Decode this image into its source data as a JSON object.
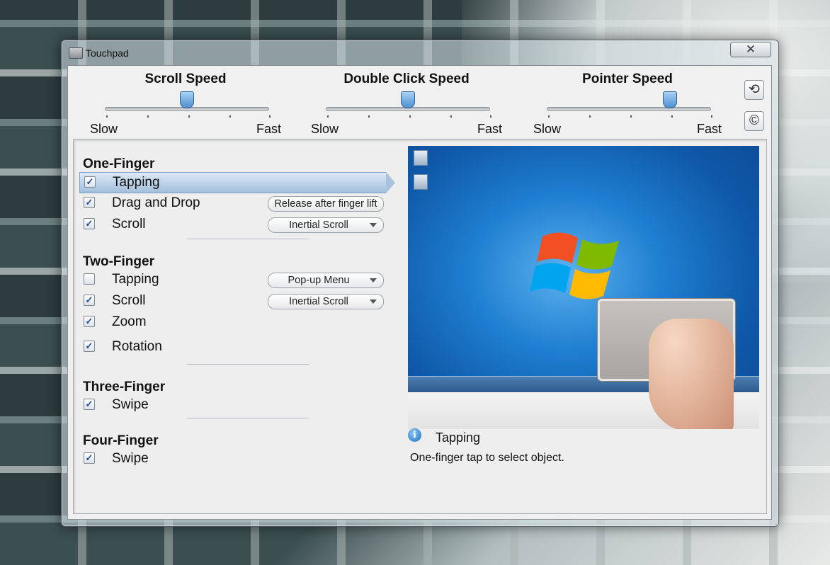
{
  "window": {
    "title": "Touchpad",
    "close_label": "✕"
  },
  "sliders": [
    {
      "title": "Scroll Speed",
      "min_label": "Slow",
      "max_label": "Fast",
      "value": 0.5
    },
    {
      "title": "Double Click Speed",
      "min_label": "Slow",
      "max_label": "Fast",
      "value": 0.5
    },
    {
      "title": "Pointer Speed",
      "min_label": "Slow",
      "max_label": "Fast",
      "value": 0.75
    }
  ],
  "side_buttons": {
    "reset_icon": "refresh-icon",
    "copyright_icon": "copyright-icon",
    "reset_glyph": "⟲",
    "copyright_glyph": "©"
  },
  "sections": {
    "one_finger": {
      "title": "One-Finger",
      "items": [
        {
          "label": "Tapping",
          "checked": true,
          "selected": true
        },
        {
          "label": "Drag and Drop",
          "checked": true,
          "button": "Release after finger lift"
        },
        {
          "label": "Scroll",
          "checked": true,
          "dropdown": "Inertial Scroll"
        }
      ]
    },
    "two_finger": {
      "title": "Two-Finger",
      "items": [
        {
          "label": "Tapping",
          "checked": false,
          "dropdown": "Pop-up Menu"
        },
        {
          "label": "Scroll",
          "checked": true,
          "dropdown": "Inertial Scroll"
        },
        {
          "label": "Zoom",
          "checked": true
        },
        {
          "label": "Rotation",
          "checked": true
        }
      ]
    },
    "three_finger": {
      "title": "Three-Finger",
      "items": [
        {
          "label": "Swipe",
          "checked": true
        }
      ]
    },
    "four_finger": {
      "title": "Four-Finger",
      "items": [
        {
          "label": "Swipe",
          "checked": true
        }
      ]
    }
  },
  "info": {
    "title": "Tapping",
    "description": "One-finger tap to select object.",
    "icon_glyph": "i"
  }
}
